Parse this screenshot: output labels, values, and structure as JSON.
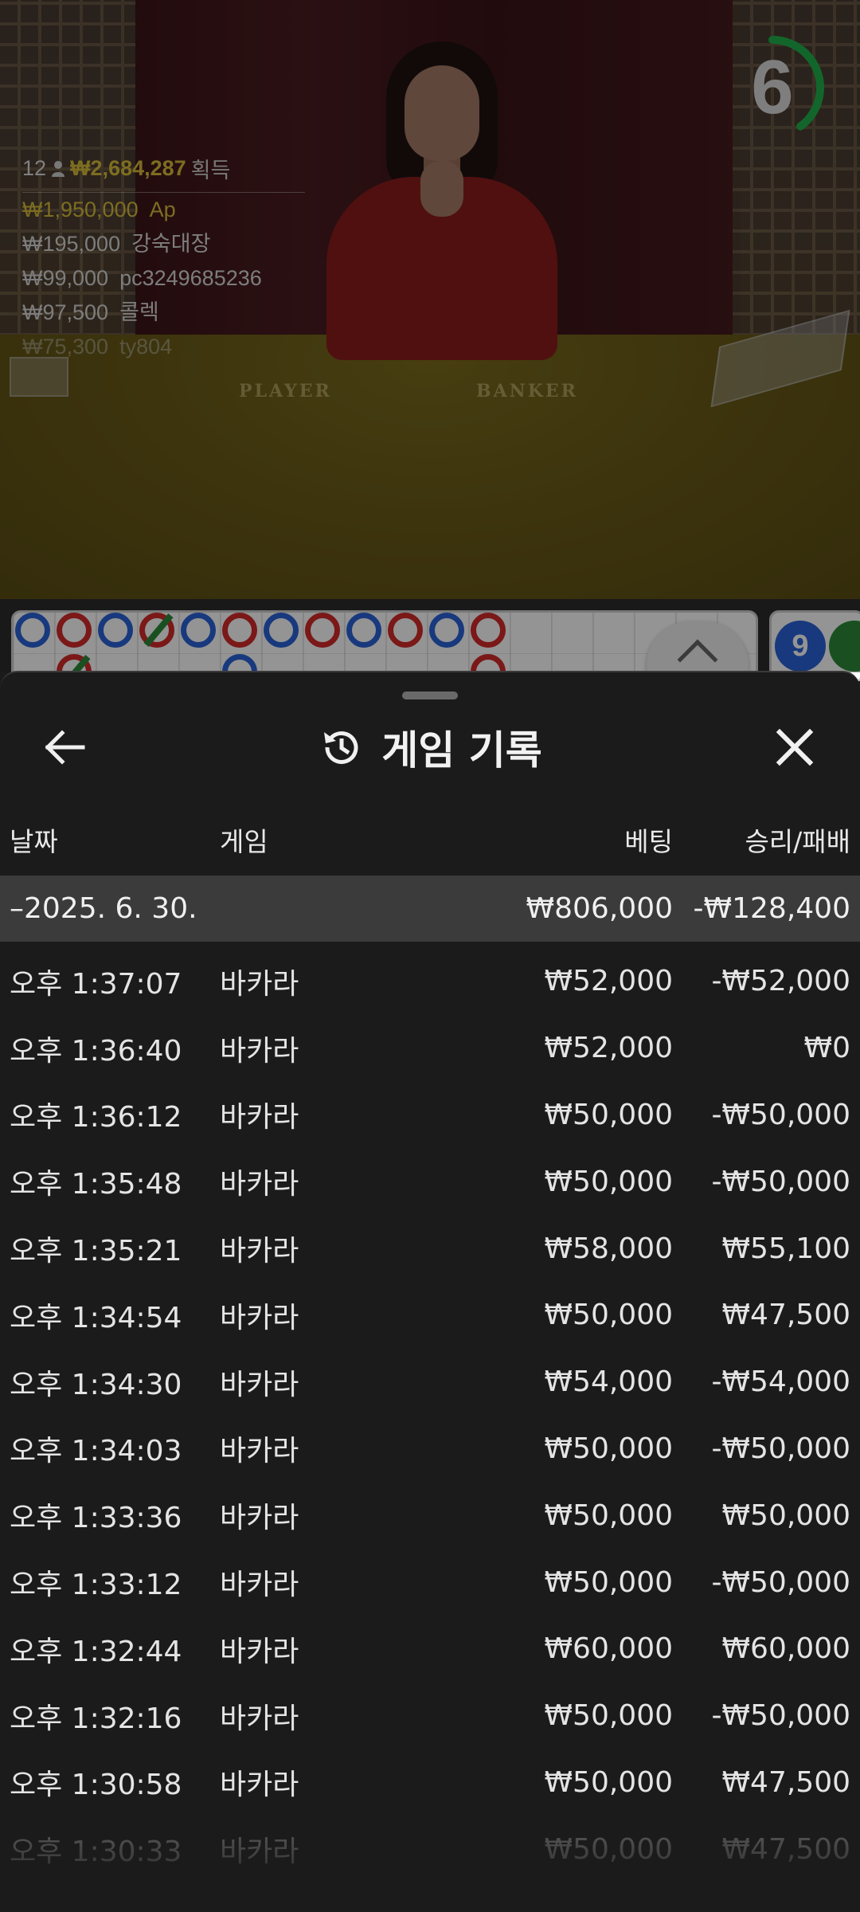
{
  "video": {
    "felt_player": "PLAYER",
    "felt_banker": "BANKER",
    "timer_value": "6",
    "timer_fraction": 0.4,
    "winners": {
      "player_count": "12",
      "total": "₩2,684,287",
      "total_suffix": "획득",
      "list": [
        {
          "amount": "₩1,950,000",
          "name": "Ap"
        },
        {
          "amount": "₩195,000",
          "name": "강숙대장"
        },
        {
          "amount": "₩99,000",
          "name": "pc3249685236"
        },
        {
          "amount": "₩97,500",
          "name": "콜렉"
        },
        {
          "amount": "₩75,300",
          "name": "ty804"
        }
      ]
    }
  },
  "side_board": {
    "ball_number": "9"
  },
  "panel": {
    "title": "게임 기록",
    "headers": {
      "date": "날짜",
      "game": "게임",
      "bet": "베팅",
      "win_loss": "승리/패배"
    },
    "group": {
      "date": "–2025. 6. 30.",
      "bet": "₩806,000",
      "win_loss": "-₩128,400"
    },
    "rows": [
      {
        "time": "오후 1:37:07",
        "game": "바카라",
        "bet": "₩52,000",
        "result": "-₩52,000"
      },
      {
        "time": "오후 1:36:40",
        "game": "바카라",
        "bet": "₩52,000",
        "result": "₩0"
      },
      {
        "time": "오후 1:36:12",
        "game": "바카라",
        "bet": "₩50,000",
        "result": "-₩50,000"
      },
      {
        "time": "오후 1:35:48",
        "game": "바카라",
        "bet": "₩50,000",
        "result": "-₩50,000"
      },
      {
        "time": "오후 1:35:21",
        "game": "바카라",
        "bet": "₩58,000",
        "result": "₩55,100"
      },
      {
        "time": "오후 1:34:54",
        "game": "바카라",
        "bet": "₩50,000",
        "result": "₩47,500"
      },
      {
        "time": "오후 1:34:30",
        "game": "바카라",
        "bet": "₩54,000",
        "result": "-₩54,000"
      },
      {
        "time": "오후 1:34:03",
        "game": "바카라",
        "bet": "₩50,000",
        "result": "-₩50,000"
      },
      {
        "time": "오후 1:33:36",
        "game": "바카라",
        "bet": "₩50,000",
        "result": "₩50,000"
      },
      {
        "time": "오후 1:33:12",
        "game": "바카라",
        "bet": "₩50,000",
        "result": "-₩50,000"
      },
      {
        "time": "오후 1:32:44",
        "game": "바카라",
        "bet": "₩60,000",
        "result": "₩60,000"
      },
      {
        "time": "오후 1:32:16",
        "game": "바카라",
        "bet": "₩50,000",
        "result": "-₩50,000"
      },
      {
        "time": "오후 1:30:58",
        "game": "바카라",
        "bet": "₩50,000",
        "result": "₩47,500"
      },
      {
        "time": "오후 1:30:33",
        "game": "바카라",
        "bet": "₩50,000",
        "result": "₩47,500"
      }
    ]
  },
  "colors": {
    "accent_gold": "#d8bc3a",
    "timer_green": "#22b04b",
    "player_blue": "#2a62d8",
    "banker_red": "#d42a2a",
    "tie_green": "#2e8a3a"
  },
  "icons": {
    "back": "arrow-left-icon",
    "close": "close-icon",
    "history": "history-icon",
    "expand": "chevron-up-icon",
    "players": "person-icon"
  }
}
